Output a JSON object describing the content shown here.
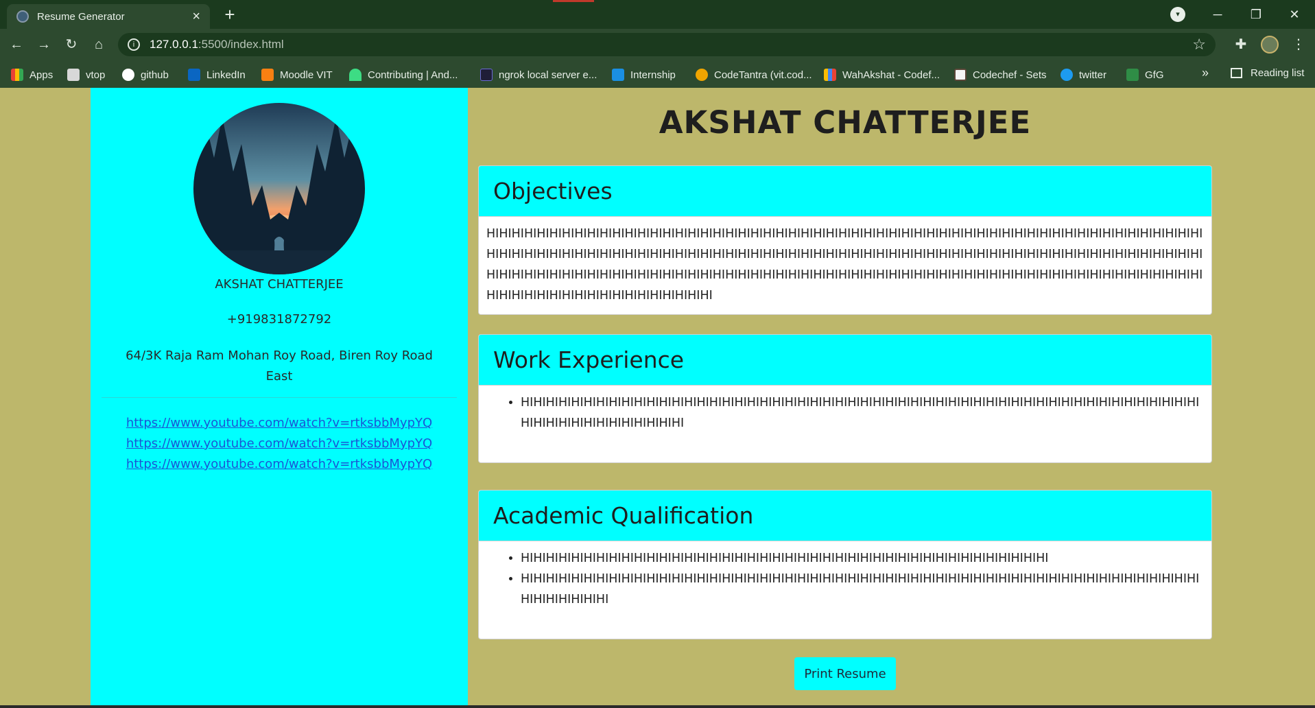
{
  "browser": {
    "tab_title": "Resume Generator",
    "tab_close": "×",
    "new_tab": "+",
    "url_host": "127.0.0.1",
    "url_path": ":5500/index.html",
    "bookmarks": [
      "Apps",
      "vtop",
      "github",
      "LinkedIn",
      "Moodle VIT",
      "Contributing | And...",
      "ngrok local server e...",
      "Internship",
      "CodeTantra (vit.cod...",
      "WahAkshat - Codef...",
      "Codechef - Sets",
      "twitter",
      "GfG"
    ],
    "more_bookmarks": "»",
    "reading_list": "Reading list"
  },
  "profile": {
    "name": "AKSHAT CHATTERJEE",
    "phone": "+919831872792",
    "address": "64/3K Raja Ram Mohan Roy Road, Biren Roy Road East",
    "links": [
      "https://www.youtube.com/watch?v=rtksbbMypYQ",
      "https://www.youtube.com/watch?v=rtksbbMypYQ",
      "https://www.youtube.com/watch?v=rtksbbMypYQ"
    ]
  },
  "main": {
    "title": "AKSHAT CHATTERJEE",
    "objectives": {
      "heading": "Objectives",
      "text": "HIHIHIHIHIHIHIHIHIHIHIHIHIHIHIHIHIHIHIHIHIHIHIHIHIHIHIHIHIHIHIHIHIHIHIHIHIHIHIHIHIHIHIHIHIHIHIHIHIHIHIHIHIHIHIHIHIHIHIHIHIHIHIHIHIHIHIHIHIHIHIHIHIHIHIHIHIHIHIHIHIHIHIHIHIHIHIHIHIHIHIHIHIHIHIHIHIHIHIHIHIHIHIHIHIHIHIHIHIHIHIHIHIHIHIHIHIHIHIHIHIHIHIHIHIHIHIHIHIHIHIHIHIHIHIHIHIHIHIHIHIHIHIHIHIHIHIHIHIHIHIHIHIHIHIHIHIHIHIHIHIHIHIHIHIHIHIHIHIHIHIHIHIHIHIHIHIHIHIHIHIHIHIHIHIHIHIHIHI"
    },
    "work": {
      "heading": "Work Experience",
      "items": [
        "HIHIHIHIHIHIHIHIHIHIHIHIHIHIHIHIHIHIHIHIHIHIHIHIHIHIHIHIHIHIHIHIHIHIHIHIHIHIHIHIHIHIHIHIHIHIHIHIHIHIHIHIHIHIHIHIHIHIHIHIHIHIHIHIHIHIHI"
      ]
    },
    "academic": {
      "heading": "Academic Qualification",
      "items": [
        "HIHIHIHIHIHIHIHIHIHIHIHIHIHIHIHIHIHIHIHIHIHIHIHIHIHIHIHIHIHIHIHIHIHIHIHIHIHIHIHIHIHI",
        "HIHIHIHIHIHIHIHIHIHIHIHIHIHIHIHIHIHIHIHIHIHIHIHIHIHIHIHIHIHIHIHIHIHIHIHIHIHIHIHIHIHIHIHIHIHIHIHIHIHIHIHIHIHIHIHIHIHIHIHIHI"
      ]
    },
    "print_label": "Print Resume"
  },
  "colors": {
    "page_bg": "#bdb76b",
    "accent": "#00ffff",
    "link": "#1a55d6"
  }
}
